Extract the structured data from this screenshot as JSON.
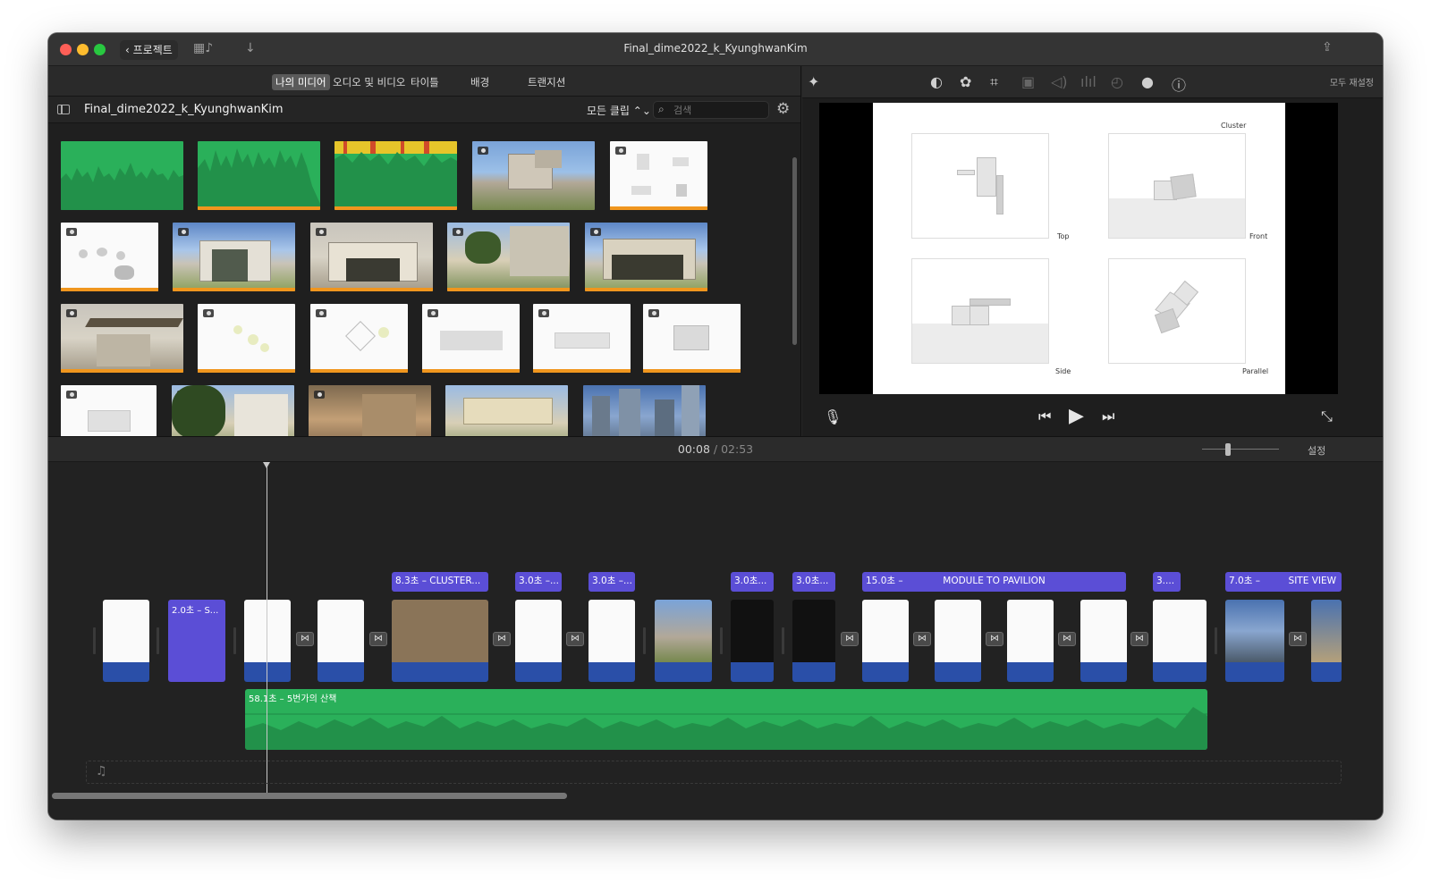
{
  "window": {
    "title": "Final_dime2022_k_KyunghwanKim",
    "back_label": "프로젝트"
  },
  "browser": {
    "tabs": [
      {
        "label": "나의 미디어",
        "active": true
      },
      {
        "label": "오디오 및 비디오",
        "active": false
      },
      {
        "label": "타이틀",
        "active": false
      },
      {
        "label": "배경",
        "active": false
      },
      {
        "label": "트랜지션",
        "active": false
      }
    ],
    "library_title": "Final_dime2022_k_KyunghwanKim",
    "filter_label": "모든 클립 ⌃⌄",
    "search_placeholder": "검색"
  },
  "viewer": {
    "reset_label": "모두 재설정",
    "view_labels": {
      "top": "Top",
      "cluster": "Cluster",
      "front": "Front",
      "side": "Side",
      "parallel": "Parallel"
    }
  },
  "timeline": {
    "current_time": "00:08",
    "separator": "/",
    "total_time": "02:53",
    "settings_label": "설정",
    "purple_clip_label": "2.0초 – S...",
    "titles": [
      {
        "left": "8.3초 – CLUSTER..."
      },
      {
        "left": "3.0초 –..."
      },
      {
        "left": "3.0초 –..."
      },
      {
        "left": "3.0초..."
      },
      {
        "left": "3.0초..."
      },
      {
        "left": "15.0초 –",
        "center": "MODULE TO PAVILION"
      },
      {
        "left": "3...."
      },
      {
        "left": "7.0초 –",
        "right": "SITE VIEW"
      }
    ],
    "audio_label": "58.1초 – 5번가의 산책"
  },
  "colors": {
    "audio_green": "#2ab05a",
    "title_purple": "#5b4ed6",
    "clip_blue": "#2a4fa8",
    "thumb_orange": "#f0961e"
  }
}
